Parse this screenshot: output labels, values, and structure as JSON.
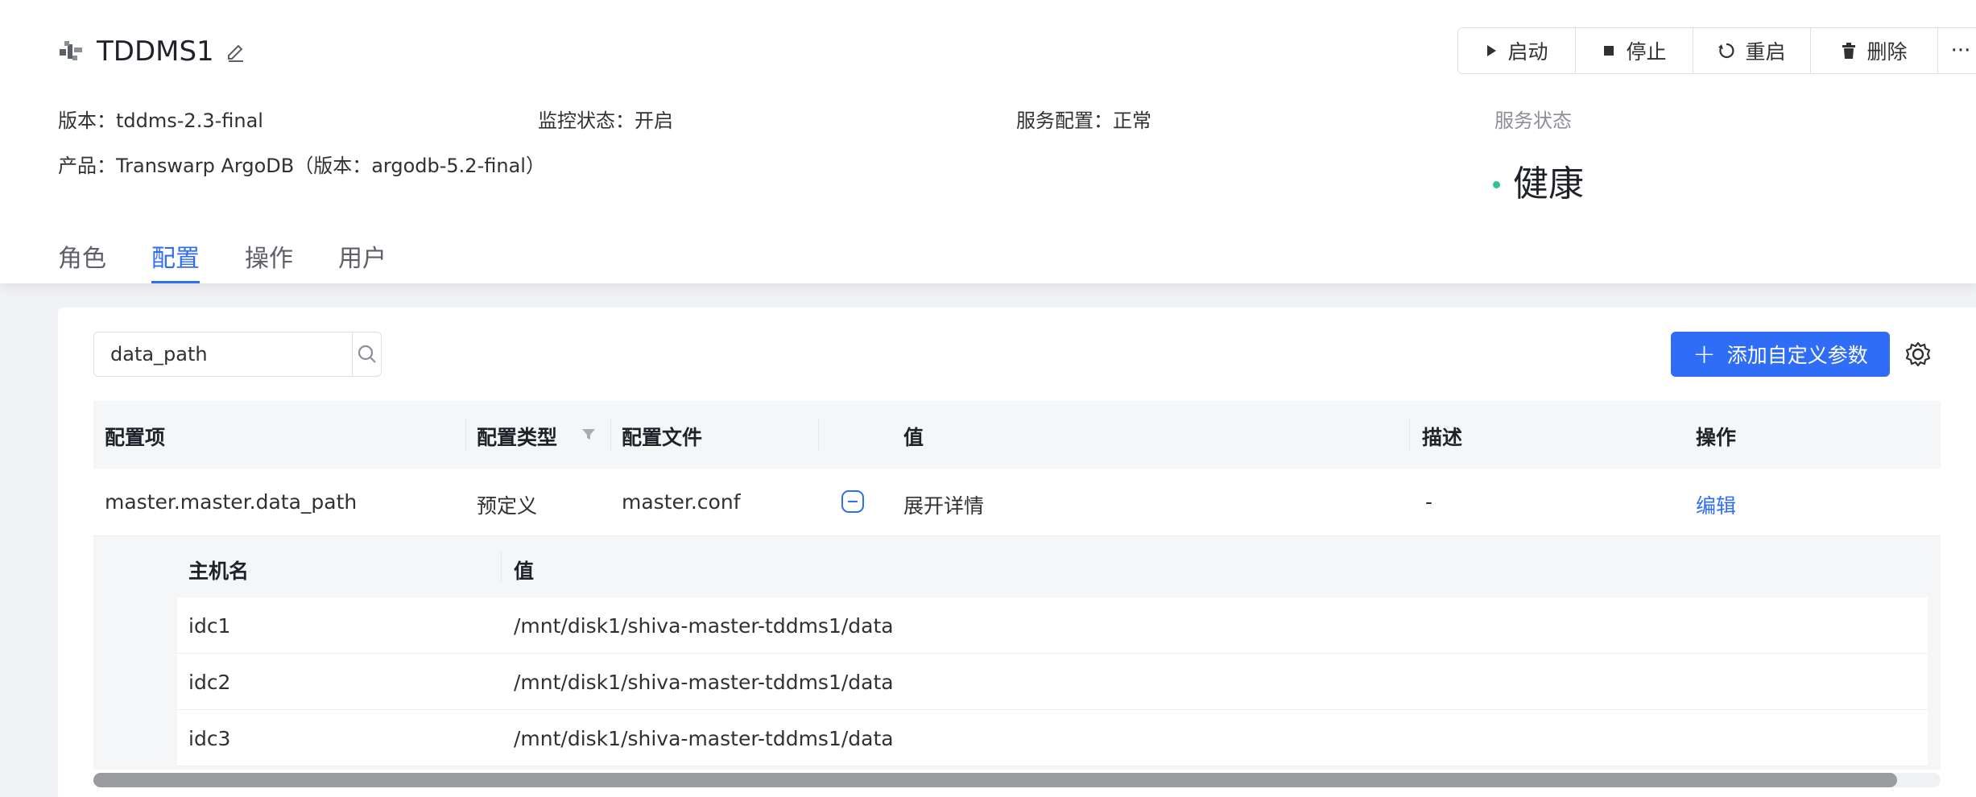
{
  "header": {
    "title": "TDDMS1",
    "actions": [
      {
        "label": "启动",
        "icon": "play-icon"
      },
      {
        "label": "停止",
        "icon": "stop-icon"
      },
      {
        "label": "重启",
        "icon": "restart-icon"
      },
      {
        "label": "删除",
        "icon": "trash-icon"
      },
      {
        "label": "···",
        "icon": "more-icon"
      }
    ],
    "meta": {
      "version_label": "版本：",
      "version": "tddms-2.3-final",
      "monitor_label": "监控状态：",
      "monitor": "开启",
      "config_label": "服务配置：",
      "config": "正常",
      "status_label": "服务状态",
      "product_label": "产品：",
      "product": "Transwarp ArgoDB（版本：argodb-5.2-final）",
      "status": "健康"
    },
    "tabs": [
      "角色",
      "配置",
      "操作",
      "用户"
    ],
    "active_tab": "配置"
  },
  "toolbar": {
    "search_value": "data_path",
    "add_label": "添加自定义参数"
  },
  "table": {
    "columns": [
      "配置项",
      "配置类型",
      "配置文件",
      "值",
      "描述",
      "操作"
    ],
    "row": {
      "name": "master.master.data_path",
      "type": "预定义",
      "file": "master.conf",
      "value": "展开详情",
      "desc": "-",
      "op": "编辑"
    },
    "sub_columns": [
      "主机名",
      "值"
    ],
    "sub_rows": [
      {
        "host": "idc1",
        "value": "/mnt/disk1/shiva-master-tddms1/data"
      },
      {
        "host": "idc2",
        "value": "/mnt/disk1/shiva-master-tddms1/data"
      },
      {
        "host": "idc3",
        "value": "/mnt/disk1/shiva-master-tddms1/data"
      }
    ]
  },
  "colors": {
    "accent": "#2f6df6",
    "healthy": "#2fc48b"
  }
}
